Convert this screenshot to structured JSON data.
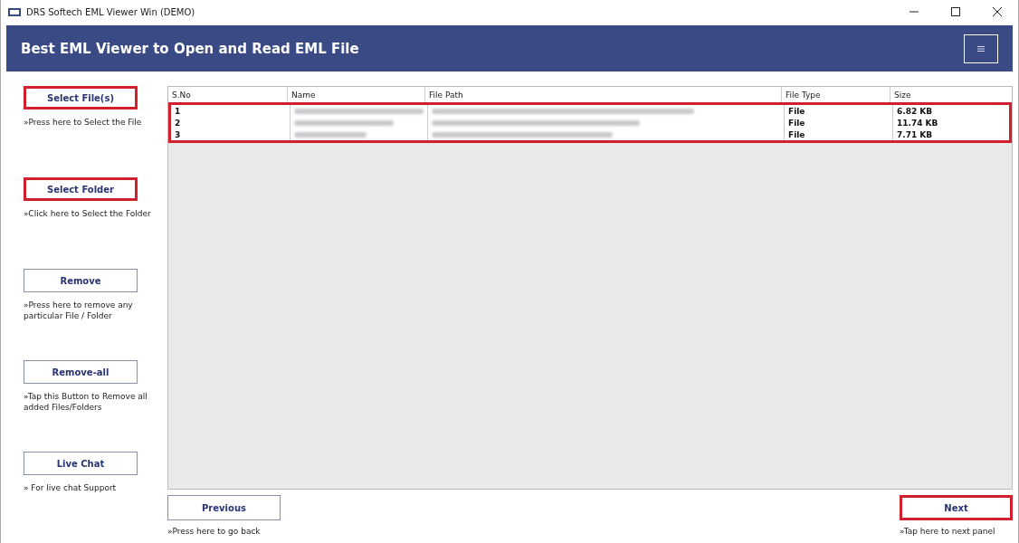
{
  "window": {
    "title": "DRS Softech EML Viewer Win (DEMO)"
  },
  "header": {
    "title": "Best EML Viewer to Open and Read EML File"
  },
  "sidebar": [
    {
      "label": "Select File(s)",
      "highlighted": true,
      "hint": "»Press here to Select the File"
    },
    {
      "label": "Select Folder",
      "highlighted": true,
      "hint": "»Click here to Select the Folder"
    },
    {
      "label": "Remove",
      "highlighted": false,
      "hint": "»Press here to remove any particular File / Folder"
    },
    {
      "label": "Remove-all",
      "highlighted": false,
      "hint": "»Tap this Button to Remove all added Files/Folders"
    },
    {
      "label": "Live Chat",
      "highlighted": false,
      "hint": "» For live chat Support"
    }
  ],
  "table": {
    "columns": [
      "S.No",
      "Name",
      "File Path",
      "File Type",
      "Size"
    ],
    "rows_highlighted": true,
    "rows": [
      {
        "sno": "1",
        "type": "File",
        "size": "6.82 KB"
      },
      {
        "sno": "2",
        "type": "File",
        "size": "11.74 KB"
      },
      {
        "sno": "3",
        "type": "File",
        "size": "7.71 KB"
      }
    ]
  },
  "footer": {
    "previous": {
      "label": "Previous",
      "highlighted": false,
      "hint": "»Press here to go back"
    },
    "next": {
      "label": "Next",
      "highlighted": true,
      "hint": "»Tap here to next panel"
    }
  }
}
